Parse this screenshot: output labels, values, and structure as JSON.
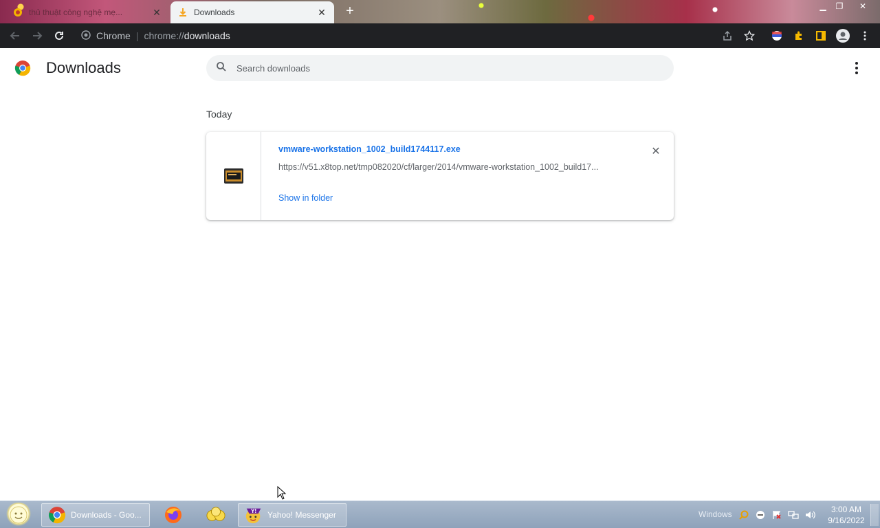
{
  "browser": {
    "tabs": [
      {
        "title": "thủ thuật công nghệ mẹ...",
        "active": false
      },
      {
        "title": "Downloads",
        "active": true
      }
    ],
    "omnibox": {
      "security_label": "Chrome",
      "url_scheme": "chrome://",
      "url_host": "downloads"
    }
  },
  "page": {
    "title": "Downloads",
    "search_placeholder": "Search downloads",
    "section_label": "Today",
    "download": {
      "file_name": "vmware-workstation_1002_build1744117.exe",
      "url": "https://v51.x8top.net/tmp082020/cf/larger/2014/vmware-workstation_1002_build17...",
      "action_label": "Show in folder"
    }
  },
  "taskbar": {
    "buttons": [
      {
        "label": "Downloads - Goo...",
        "icon": "chrome-icon"
      },
      {
        "label": "",
        "icon": "firefox-icon"
      },
      {
        "label": "",
        "icon": "folder-icon"
      },
      {
        "label": "Yahoo! Messenger",
        "icon": "yahoo-messenger-icon"
      }
    ],
    "tray_label": "Windows",
    "time": "3:00 AM",
    "date": "9/16/2022"
  },
  "colors": {
    "link": "#1a73e8",
    "toolbar": "#202124",
    "taskbar": "#8ea2ba"
  }
}
